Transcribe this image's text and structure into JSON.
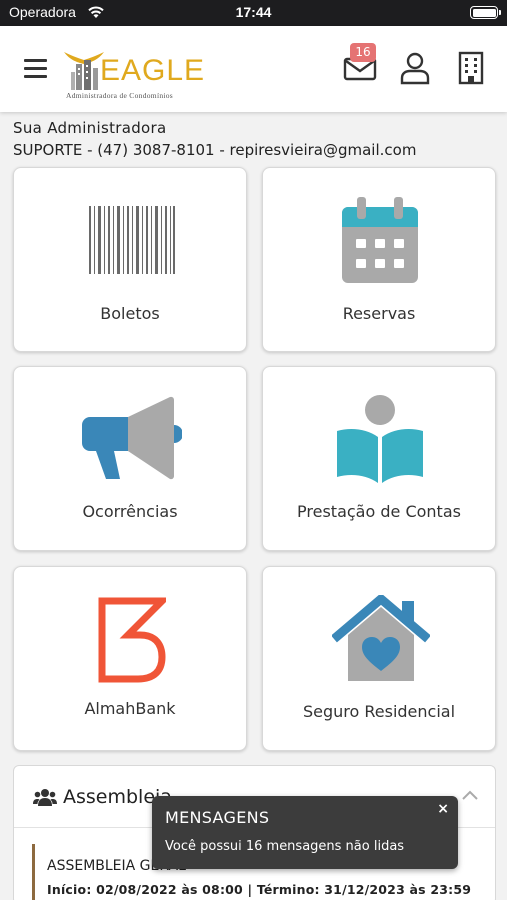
{
  "status_bar": {
    "carrier": "Operadora",
    "time": "17:44"
  },
  "header": {
    "logo_word": "EAGLE",
    "logo_sub": "Administradora de Condomínios",
    "unread_count": "16"
  },
  "admin": {
    "title": "Sua Administradora",
    "contact": "SUPORTE - (47) 3087-8101 - repiresvieira@gmail.com"
  },
  "tiles": [
    {
      "label": "Boletos",
      "icon": "barcode-icon"
    },
    {
      "label": "Reservas",
      "icon": "calendar-icon"
    },
    {
      "label": "Ocorrências",
      "icon": "megaphone-icon"
    },
    {
      "label": "Prestação de Contas",
      "icon": "book-reader-icon"
    },
    {
      "label": "AlmahBank",
      "icon": "almahbank-logo-icon"
    },
    {
      "label": "Seguro Residencial",
      "icon": "home-heart-icon"
    }
  ],
  "assembleia": {
    "title": "Assembleia",
    "item_name": "ASSEMBLEIA GERAL",
    "item_dates": "Início: 02/08/2022 às 08:00 | Término: 31/12/2023 às 23:59"
  },
  "toast": {
    "title": "MENSAGENS",
    "message": "Você possui 16 mensagens não lidas",
    "close": "×"
  },
  "colors": {
    "brand_gold": "#e0a91e",
    "calendar_teal": "#3ab0c3",
    "megaphone_blue": "#3a87b8",
    "almah_red": "#f05537",
    "house_blue": "#3a87b8",
    "badge_red": "#e57373"
  }
}
